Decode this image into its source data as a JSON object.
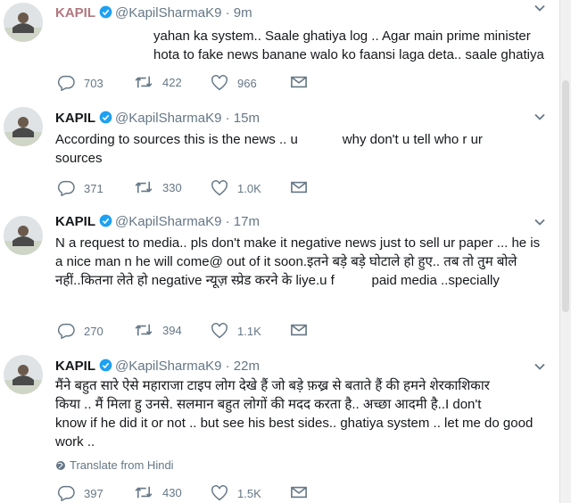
{
  "tweets": [
    {
      "name": "KAPIL",
      "handle": "@KapilSharmaK9",
      "dot": "·",
      "time": "9m",
      "text": "yahan ka system.. Saale ghatiya log .. Agar main prime minister\nhota to fake news banane walo ko faansi laga deta.. saale ghatiya",
      "replies": "703",
      "retweets": "422",
      "likes": "966"
    },
    {
      "name": "KAPIL",
      "handle": "@KapilSharmaK9",
      "dot": "·",
      "time": "15m",
      "text": "According to sources this is the news .. u            why don't u tell who r ur\nsources",
      "replies": "371",
      "retweets": "330",
      "likes": "1.0K"
    },
    {
      "name": "KAPIL",
      "handle": "@KapilSharmaK9",
      "dot": "·",
      "time": "17m",
      "text": "N a request to media.. pls don't make it negative news just to sell ur paper ... he is\na nice man n he will come@ out of it soon.इतने बड़े बड़े घोटाले हो हुए.. तब तो तुम बोले\nनहीं..कितना लेते हो negative न्यूज़ स्प्रेड करने के liye.u f          paid media ..specially",
      "replies": "270",
      "retweets": "394",
      "likes": "1.1K"
    },
    {
      "name": "KAPIL",
      "handle": "@KapilSharmaK9",
      "dot": "·",
      "time": "22m",
      "text": "मैंने बहुत सारे ऐसे महाराजा टाइप लोग देखे हैं जो बड़े फ़ख्र से बताते हैं की हमने शेरकाशिकार\nकिया .. मैं मिला हु उनसे. सलमान बहुत लोगों की मदद करता है.. अच्छा आदमी है..I don't\nknow if he did it or not .. but see his best sides.. ghatiya system .. let me do good\nwork ..",
      "translate": "Translate from Hindi",
      "replies": "397",
      "retweets": "430",
      "likes": "1.5K"
    }
  ],
  "colors": {
    "verified": "#1da1f2",
    "meta": "#657786",
    "text": "#14171a",
    "divider": "#e6ecf0"
  },
  "icons": [
    "avatar",
    "verified-badge-icon",
    "chevron-down-icon",
    "reply-icon",
    "retweet-icon",
    "like-icon",
    "dm-icon",
    "globe-icon"
  ]
}
